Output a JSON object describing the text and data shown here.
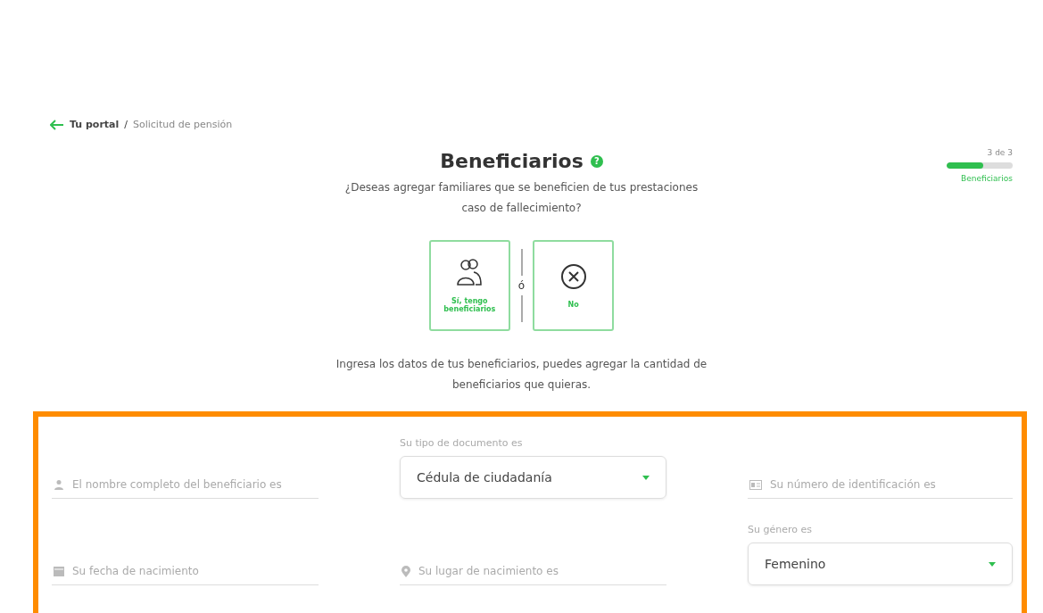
{
  "breadcrumb": {
    "parent": "Tu portal",
    "separator": "/",
    "current": "Solicitud de pensión"
  },
  "progress": {
    "step": "3 de 3",
    "level": 0.55,
    "label": "Beneficiarios"
  },
  "header": {
    "title": "Beneficiarios",
    "help": "?",
    "question": "¿Deseas agregar familiares que se beneficien de tus prestaciones caso de fallecimiento?"
  },
  "choices": [
    {
      "kind": "yes",
      "label": "Sí, tengo beneficiarios"
    },
    {
      "kind": "no",
      "label": "No"
    }
  ],
  "choice_separator": "ó",
  "instructions": "Ingresa los datos de tus beneficiarios, puedes agregar la cantidad de beneficiarios que quieras.",
  "fields": [
    {
      "kind": "text",
      "placeholder": "El nombre completo del beneficiario es"
    },
    {
      "kind": "select",
      "label": "Su tipo de documento es",
      "value": "Cédula de ciudadanía"
    },
    {
      "kind": "text",
      "placeholder": "Su número de identificación es"
    },
    {
      "kind": "text",
      "placeholder": "Su fecha de nacimiento"
    },
    {
      "kind": "text",
      "placeholder": "Su lugar de nacimiento es"
    },
    {
      "kind": "select",
      "label": "Su género es",
      "value": "Femenino"
    }
  ]
}
